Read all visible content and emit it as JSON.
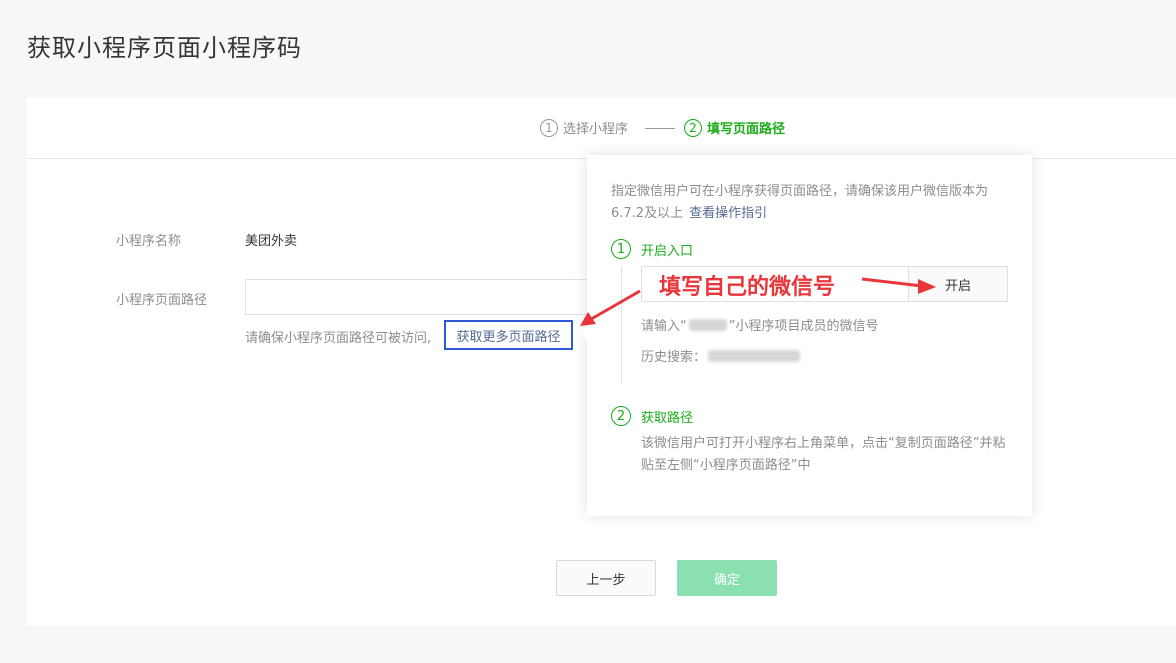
{
  "page": {
    "title": "获取小程序页面小程序码"
  },
  "steps": {
    "step1": {
      "num": "1",
      "label": "选择小程序"
    },
    "step2": {
      "num": "2",
      "label": "填写页面路径"
    }
  },
  "form": {
    "name_label": "小程序名称",
    "name_value": "美团外卖",
    "path_label": "小程序页面路径",
    "path_value": "",
    "hint": "请确保小程序页面路径可被访问,",
    "more_link": "获取更多页面路径"
  },
  "buttons": {
    "prev": "上一步",
    "confirm": "确定"
  },
  "popover": {
    "desc": "指定微信用户可在小程序获得页面路径，请确保该用户微信版本为6.7.2及以上",
    "guide_link": "查看操作指引",
    "sec1": {
      "num": "1",
      "title": "开启入口"
    },
    "wx_input_value": "",
    "open_button": "开启",
    "input_hint_prefix": "请输入“",
    "input_hint_suffix": "”小程序项目成员的微信号",
    "history_label": "历史搜索：",
    "sec2": {
      "num": "2",
      "title": "获取路径"
    },
    "sec2_desc": "该微信用户可打开小程序右上角菜单，点击“复制页面路径”并粘贴至左侧“小程序页面路径”中"
  },
  "annotation": {
    "text": "填写自己的微信号",
    "color": "#e8363a"
  },
  "colors": {
    "brand_green": "#1aad19",
    "link": "#576b95",
    "highlight_box": "#2d58d6"
  }
}
